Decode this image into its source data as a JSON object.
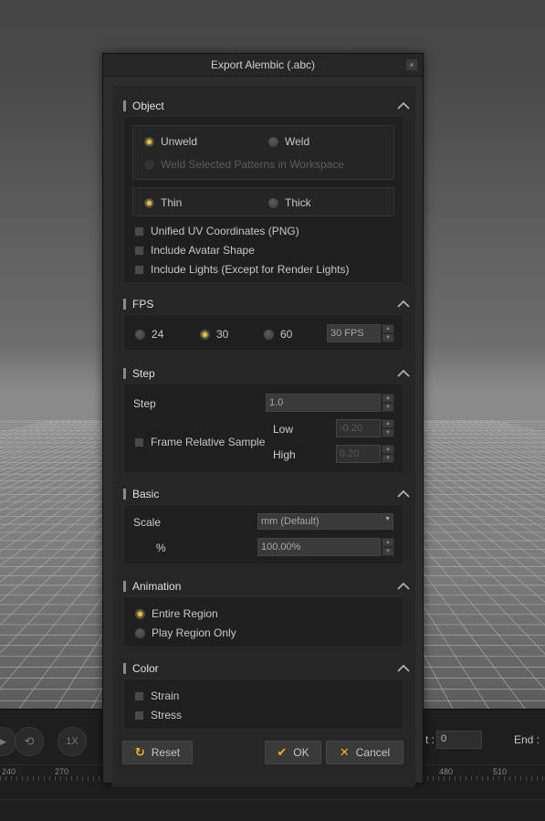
{
  "dialog": {
    "title": "Export Alembic (.abc)",
    "close": "×"
  },
  "object": {
    "title": "Object",
    "unweld": "Unweld",
    "weld": "Weld",
    "weld_selected": "Weld Selected Patterns in Workspace",
    "thin": "Thin",
    "thick": "Thick",
    "unified_uv": "Unified UV Coordinates (PNG)",
    "include_avatar": "Include Avatar Shape",
    "include_lights": "Include Lights (Except for Render Lights)"
  },
  "fps": {
    "title": "FPS",
    "opt24": "24",
    "opt30": "30",
    "opt60": "60",
    "value": "30 FPS"
  },
  "step": {
    "title": "Step",
    "step_label": "Step",
    "step_value": "1.0",
    "frame_relative": "Frame Relative Sample",
    "low_label": "Low",
    "low_value": "-0.20",
    "high_label": "High",
    "high_value": "0.20"
  },
  "basic": {
    "title": "Basic",
    "scale_label": "Scale",
    "scale_value": "mm (Default)",
    "percent_label": "%",
    "percent_value": "100.00%"
  },
  "animation": {
    "title": "Animation",
    "entire": "Entire Region",
    "play_only": "Play Region Only"
  },
  "color": {
    "title": "Color",
    "strain": "Strain",
    "stress": "Stress"
  },
  "buttons": {
    "reset": "Reset",
    "ok": "OK",
    "cancel": "Cancel"
  },
  "timeline": {
    "speed": "1X",
    "start_suffix": "t :",
    "start_value": "0",
    "end_label": "End :",
    "ticks": [
      "240",
      "270",
      "480",
      "510"
    ]
  },
  "colors": {
    "accent": "#f4c400",
    "dialog_bg": "#2d2d2d",
    "panel_bg": "#1d1d1d"
  }
}
